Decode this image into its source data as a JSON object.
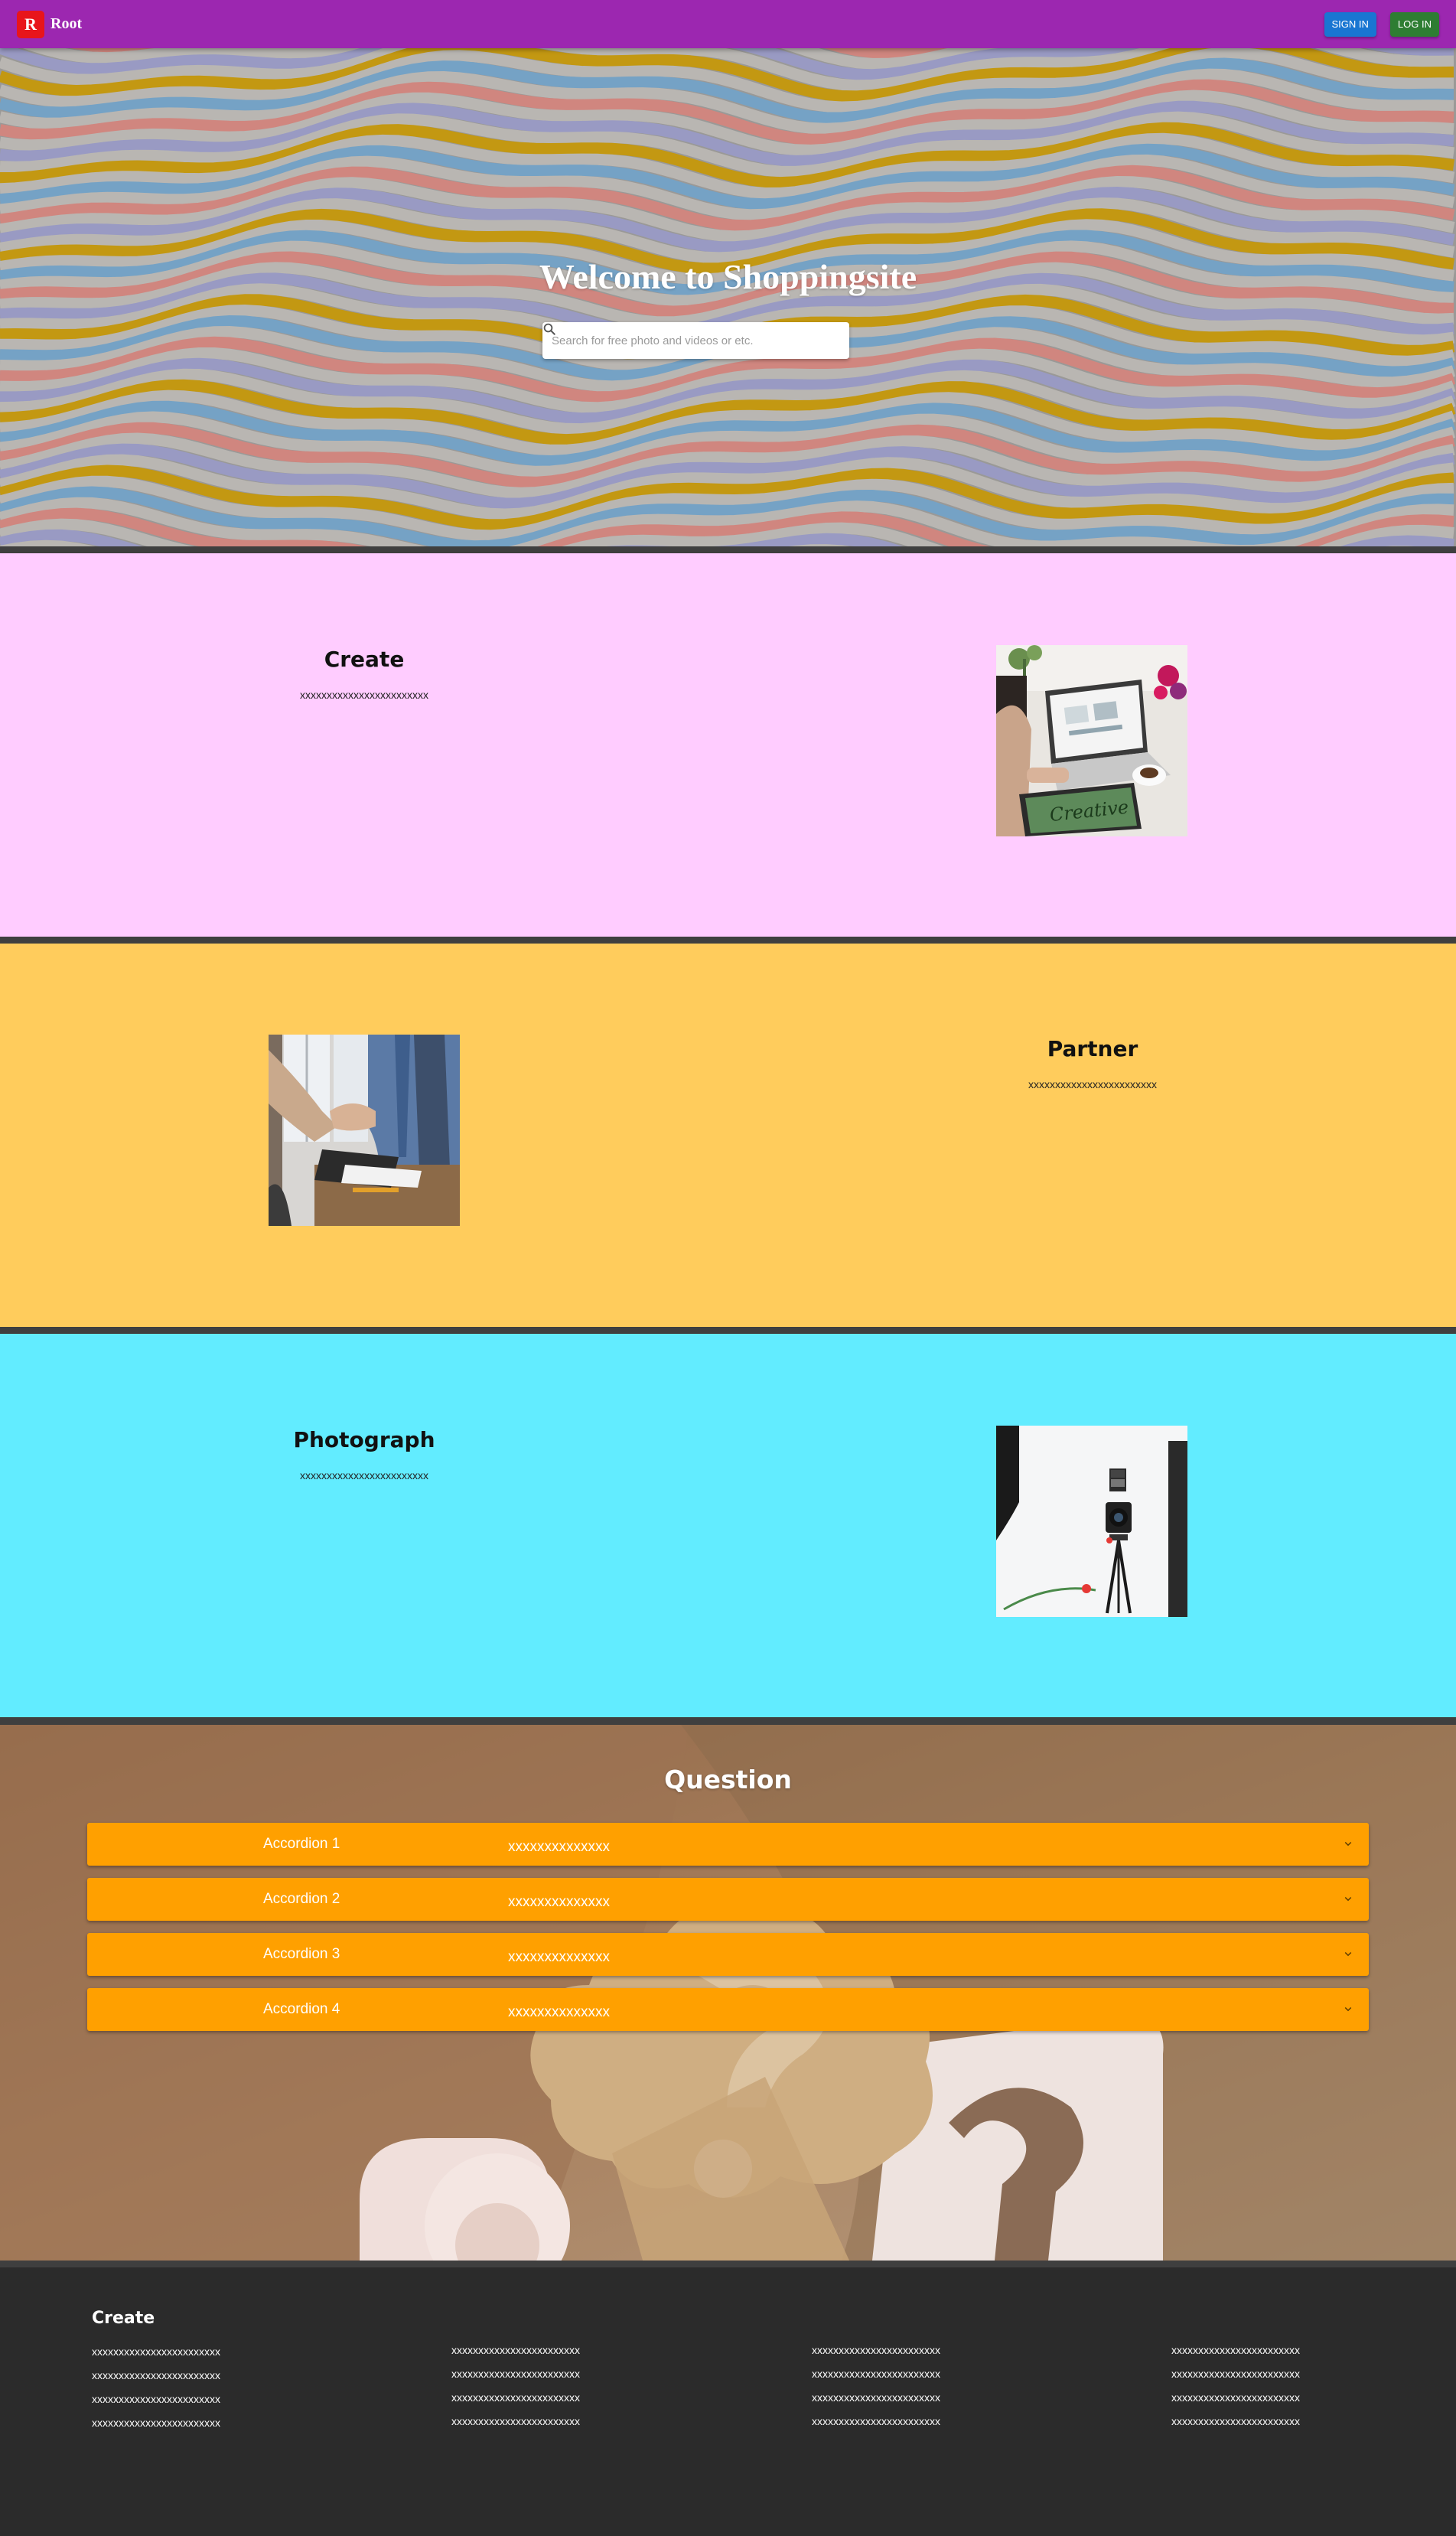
{
  "navbar": {
    "brand_mark": "R",
    "brand_name": "Root",
    "signin_label": "SIGN IN",
    "login_label": "LOG IN"
  },
  "hero": {
    "title": "Welcome to Shoppingsite",
    "search_placeholder": "Search for free photo and videos or etc.",
    "search_icon": "search-icon"
  },
  "features": [
    {
      "title": "Create",
      "description": "xxxxxxxxxxxxxxxxxxxxxxxx",
      "image": "laptop-workspace-photo",
      "background": "#ffccff"
    },
    {
      "title": "Partner",
      "description": "xxxxxxxxxxxxxxxxxxxxxxxx",
      "image": "handshake-photo",
      "background": "#ffcc5c"
    },
    {
      "title": "Photograph",
      "description": "xxxxxxxxxxxxxxxxxxxxxxxx",
      "image": "camera-studio-photo",
      "background": "#62ecff"
    }
  ],
  "question": {
    "title": "Question",
    "accordions": [
      {
        "label": "Accordion 1",
        "value": "xxxxxxxxxxxxxx"
      },
      {
        "label": "Accordion 2",
        "value": "xxxxxxxxxxxxxx"
      },
      {
        "label": "Accordion 3",
        "value": "xxxxxxxxxxxxxx"
      },
      {
        "label": "Accordion 4",
        "value": "xxxxxxxxxxxxxx"
      }
    ]
  },
  "footer": {
    "col1": {
      "title": "Create",
      "links": [
        "xxxxxxxxxxxxxxxxxxxxxxxx",
        "xxxxxxxxxxxxxxxxxxxxxxxx",
        "xxxxxxxxxxxxxxxxxxxxxxxx",
        "xxxxxxxxxxxxxxxxxxxxxxxx"
      ]
    },
    "col2": {
      "links": [
        "xxxxxxxxxxxxxxxxxxxxxxxx",
        "xxxxxxxxxxxxxxxxxxxxxxxx",
        "xxxxxxxxxxxxxxxxxxxxxxxx",
        "xxxxxxxxxxxxxxxxxxxxxxxx"
      ]
    },
    "col3": {
      "links": [
        "xxxxxxxxxxxxxxxxxxxxxxxx",
        "xxxxxxxxxxxxxxxxxxxxxxxx",
        "xxxxxxxxxxxxxxxxxxxxxxxx",
        "xxxxxxxxxxxxxxxxxxxxxxxx"
      ]
    },
    "col4": {
      "links": [
        "xxxxxxxxxxxxxxxxxxxxxxxx",
        "xxxxxxxxxxxxxxxxxxxxxxxx",
        "xxxxxxxxxxxxxxxxxxxxxxxx",
        "xxxxxxxxxxxxxxxxxxxxxxxx"
      ]
    }
  },
  "colors": {
    "navbar": "#9c27b0",
    "signin_button": "#1976d2",
    "login_button": "#2e7d32",
    "accordion": "#ffa000",
    "footer": "#2b2b2b",
    "divider": "#3f3f3f"
  }
}
